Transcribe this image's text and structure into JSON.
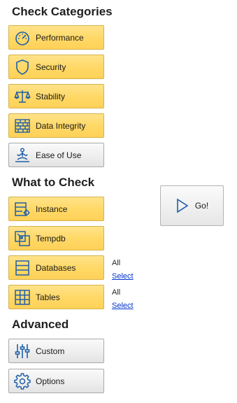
{
  "sections": {
    "check_categories": "Check Categories",
    "what_to_check": "What to Check",
    "advanced": "Advanced"
  },
  "categories": {
    "performance": "Performance",
    "security": "Security",
    "stability": "Stability",
    "data_integrity": "Data Integrity",
    "ease_of_use": "Ease of Use"
  },
  "targets": {
    "instance": "Instance",
    "tempdb": "Tempdb",
    "databases": {
      "label": "Databases",
      "scope": "All",
      "select": "Select"
    },
    "tables": {
      "label": "Tables",
      "scope": "All",
      "select": "Select"
    }
  },
  "advanced": {
    "custom": "Custom",
    "options": "Options"
  },
  "go_button": "Go!",
  "colors": {
    "selected_fill": "#ffd865",
    "selected_border": "#d6b24a",
    "icon_blue": "#1f5fa8",
    "link": "#0033cc"
  },
  "icons": {
    "performance": "speedometer-icon",
    "security": "shield-icon",
    "stability": "scales-icon",
    "data_integrity": "brick-wall-icon",
    "ease_of_use": "meditating-person-icon",
    "instance": "server-gear-icon",
    "tempdb": "resize-icon",
    "databases": "database-rows-icon",
    "tables": "grid-table-icon",
    "custom": "sliders-icon",
    "options": "gear-icon",
    "go": "play-icon"
  }
}
